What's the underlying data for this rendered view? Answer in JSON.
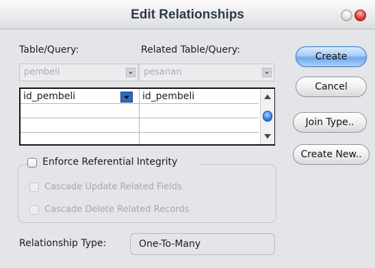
{
  "window": {
    "title": "Edit Relationships"
  },
  "labels": {
    "table_query": "Table/Query:",
    "related_table_query": "Related Table/Query:",
    "relationship_type": "Relationship Type:"
  },
  "combos": {
    "table": {
      "value": "pembeli"
    },
    "related_table": {
      "value": "pesanan"
    }
  },
  "field_grid": {
    "rows": [
      {
        "left": "id_pembeli",
        "right": "id_pembeli"
      },
      {
        "left": "",
        "right": ""
      },
      {
        "left": "",
        "right": ""
      },
      {
        "left": "",
        "right": ""
      }
    ]
  },
  "options": {
    "enforce_referential_integrity": {
      "label": "Enforce Referential Integrity",
      "checked": false,
      "enabled": true
    },
    "cascade_update": {
      "label": "Cascade Update Related Fields",
      "checked": false,
      "enabled": false
    },
    "cascade_delete": {
      "label": "Cascade Delete Related Records",
      "checked": false,
      "enabled": false
    }
  },
  "relationship_type": {
    "value": "One-To-Many"
  },
  "buttons": {
    "create": "Create",
    "cancel": "Cancel",
    "join_type": "Join Type..",
    "create_new": "Create New.."
  }
}
